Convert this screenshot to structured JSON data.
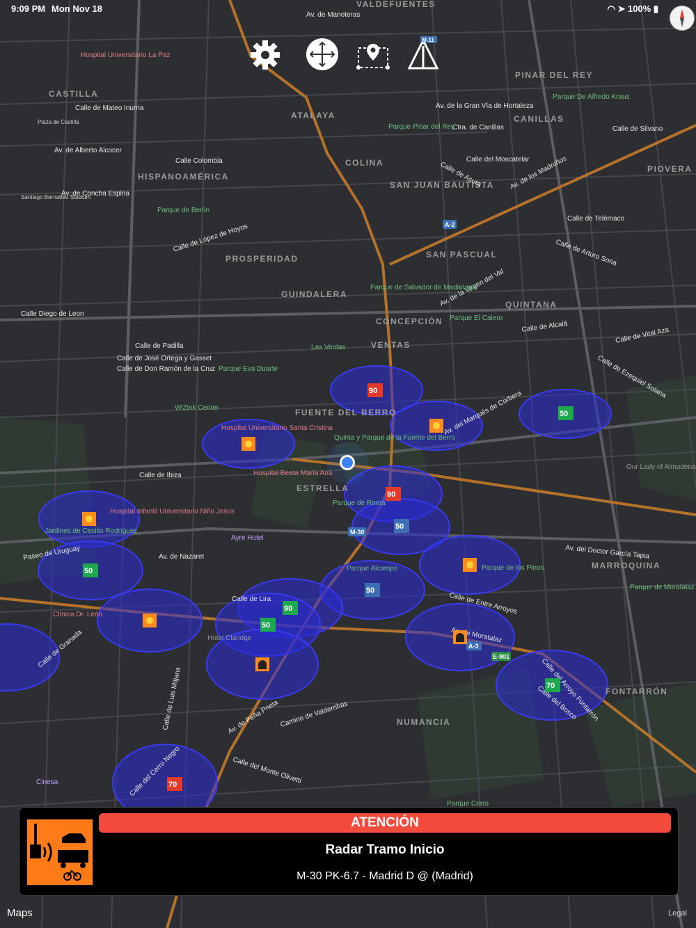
{
  "status": {
    "time": "9:09 PM",
    "date": "Mon Nov 18",
    "battery": "100%"
  },
  "toolbar": {
    "settings_icon": "gear-icon",
    "recenter_icon": "move-arrows-icon",
    "route_icon": "route-pin-icon",
    "road_icon": "road-perspective-icon",
    "road_badge": "M-11"
  },
  "alert": {
    "banner": "ATENCIÓN",
    "title": "Radar Tramo Inicio",
    "subtitle": "M-30 PK-6.7 - Madrid D @ (Madrid)",
    "icon": "speed-radar-icon"
  },
  "map": {
    "districts": [
      "VALDEFUENTES",
      "CASTILLA",
      "ATALAYA",
      "PINAR DEL REY",
      "CANILLAS",
      "COLINA",
      "SAN JUAN BAUTISTA",
      "PIOVERA",
      "HISPANOAMÉRICA",
      "PROSPERIDAD",
      "SAN PASCUAL",
      "GUINDALERA",
      "QUINTANA",
      "CONCEPCIÓN",
      "VENTAS",
      "FUENTE DEL BERRO",
      "ESTRELLA",
      "MARROQUINA",
      "FONTARRÓN",
      "NUMANCIA"
    ],
    "streets": [
      "Av. de Manoteras",
      "Calle de Mateo Inurria",
      "Av. de la Gran Vía de Hortaleza",
      "Ctra. de Canillas",
      "Calle de Silvano",
      "Av. de Alberto Alcocer",
      "Calle del Moscatelar",
      "Av. de los Madroños",
      "Calle de Asura",
      "Calle Colombia",
      "Av. de Concha Espina",
      "Calle de López de Hoyos",
      "Calle de Telémaco",
      "Calle de Arturo Soria",
      "Av. de la Virgen del Val",
      "Calle de Alcalá",
      "Calle de Vital Aza",
      "Calle de Ezequiel Solana",
      "Av. del Marqués de Corbera",
      "Calle Diego de Leon",
      "Calle de José Ortega y Gasset",
      "Calle de Don Ramón de la Cruz",
      "Calle de Padilla",
      "Calle de Ibiza",
      "Av. de Nazaret",
      "Av. del Doctor García Tapia",
      "Paseo de Uruguay",
      "Calle de Lira",
      "Calle de Entre Arroyos",
      "Av. de Moratalaz",
      "Calle del Arroyo Fontarrón",
      "Camino de Valderribas",
      "Calle del Monte Olivetti",
      "Av. de Peña Prieta",
      "Calle del Cerro Negro",
      "Calle de Luis Mitjans",
      "Calle de Granada",
      "Calle del Bosco"
    ],
    "places": [
      "Hospital Universitario La Paz",
      "Parque Pinar del Rey",
      "Parque De Alfredo Kraus",
      "Parque de Berlín",
      "Parque de Salvador de Madariaga",
      "Parque El Calero",
      "Las Ventas",
      "Parque Eva Duarte",
      "WiZink Center",
      "Quinta y Parque de la Fuente del Berro",
      "Parque de Roma",
      "Parque Alcampo",
      "Parque de los Pinos",
      "Parque de Moratalaz",
      "Our Lady of Almudena Cemetery",
      "Hospital Universitario Santa Cristina",
      "Hospital Beata María Ana",
      "Hospital Infantil Universitario Niño Jesús",
      "Jardines de Cecilio Rodríguez",
      "Ayre Hotel",
      "Hotel Claridge",
      "Clínica Dr. León",
      "Cinesa",
      "Parque Cerro",
      "Santiago Bernabéu Stadium",
      "Plaza de Castilla"
    ],
    "road_shields": [
      "A-2",
      "M-30",
      "A-3",
      "E-901"
    ],
    "cameras": [
      {
        "type": "speed",
        "label": "90"
      },
      {
        "type": "light",
        "label": ""
      },
      {
        "type": "section",
        "label": "50"
      },
      {
        "type": "light",
        "label": ""
      },
      {
        "type": "light",
        "label": ""
      },
      {
        "type": "speed",
        "label": "90"
      },
      {
        "type": "section",
        "label": "50"
      },
      {
        "type": "section",
        "label": "50"
      },
      {
        "type": "light",
        "label": ""
      },
      {
        "type": "section",
        "label": "50"
      },
      {
        "type": "light",
        "label": ""
      },
      {
        "type": "section",
        "label": "90"
      },
      {
        "type": "section",
        "label": "50"
      },
      {
        "type": "tunnel",
        "label": ""
      },
      {
        "type": "tunnel",
        "label": ""
      },
      {
        "type": "section",
        "label": "70"
      },
      {
        "type": "speed",
        "label": "70"
      }
    ]
  },
  "footer": {
    "maps_label": "Maps",
    "legal": "Legal"
  },
  "colors": {
    "accent": "#f24a3d",
    "radar": "#ff7b17",
    "user_dot": "#3b82f6",
    "zone": "#2a2bd6"
  }
}
